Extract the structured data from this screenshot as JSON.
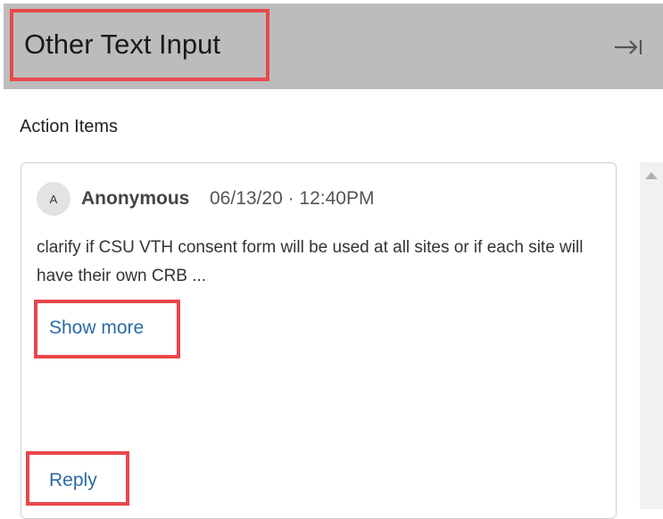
{
  "panel": {
    "title": "Other Text Input",
    "collapse_icon": "collapse-right-icon",
    "section_label": "Action Items"
  },
  "comment": {
    "avatar_initial": "A",
    "author": "Anonymous",
    "timestamp": "06/13/20 · 12:40PM",
    "text": "clarify if CSU VTH consent form will be used at all sites or if each site will have their own CRB ...",
    "show_more_label": "Show more",
    "reply_label": "Reply"
  },
  "colors": {
    "header_bg": "#bcbcbc",
    "link": "#2d6aa6",
    "highlight": "#e8474c"
  }
}
